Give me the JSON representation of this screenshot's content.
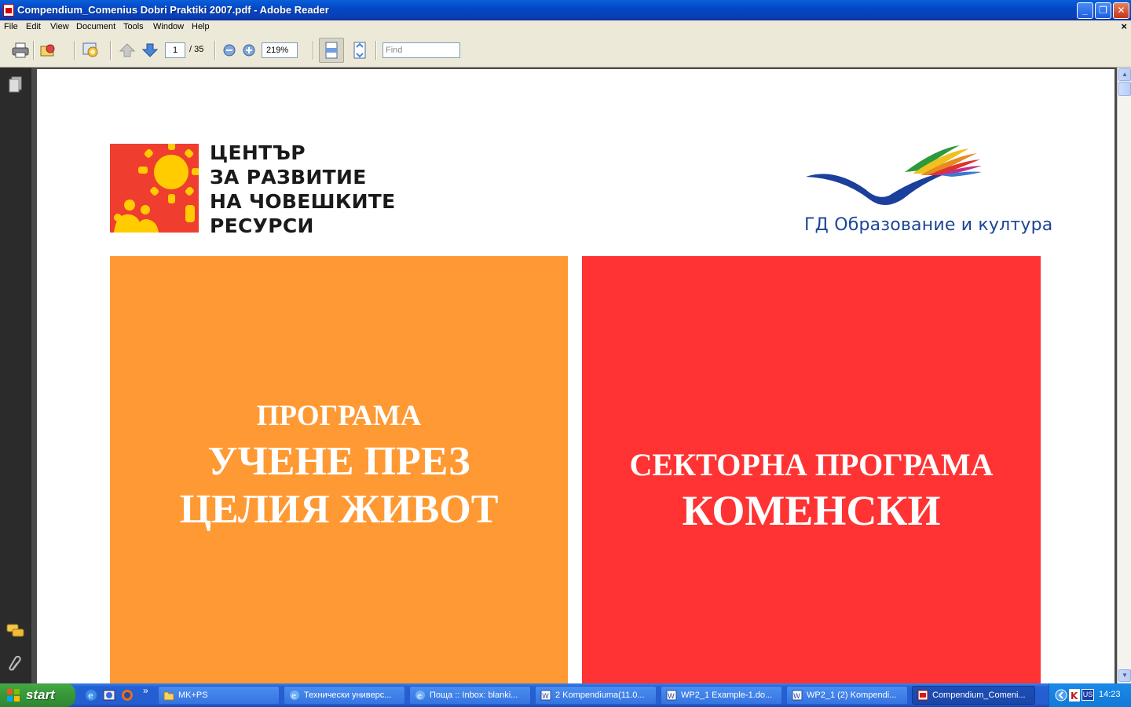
{
  "window": {
    "title": "Compendium_Comenius Dobri Praktiki 2007.pdf - Adobe Reader",
    "controls": {
      "minimize": "_",
      "restore": "❐",
      "close": "✕"
    }
  },
  "menubar": {
    "items": [
      "File",
      "Edit",
      "View",
      "Document",
      "Tools",
      "Window",
      "Help"
    ],
    "doc_close": "×"
  },
  "toolbar": {
    "page_current": "1",
    "page_total": "/ 35",
    "zoom": "219%",
    "find_placeholder": "Find"
  },
  "document": {
    "left_logo_lines": [
      "ЦЕНТЪР",
      "ЗА РАЗВИТИЕ",
      "НА ЧОВЕШКИТЕ",
      "РЕСУРСИ"
    ],
    "right_logo_caption": "ГД  Образование и култура",
    "orange_block": {
      "line1": "ПРОГРАМА",
      "line2": "УЧЕНЕ ПРЕЗ",
      "line3": "ЦЕЛИЯ ЖИВОТ",
      "color": "#ff9933"
    },
    "red_block": {
      "line1": "СЕКТОРНА ПРОГРАМА",
      "line2": "КОМЕНСКИ",
      "color": "#ff3333"
    }
  },
  "taskbar": {
    "start_label": "start",
    "quicklaunch_more": "»",
    "buttons": [
      {
        "label": "MK+PS",
        "icon": "folder-icon"
      },
      {
        "label": "Технически универс...",
        "icon": "ie-icon"
      },
      {
        "label": "Поща :: Inbox: blanki...",
        "icon": "ie-icon"
      },
      {
        "label": "2 Kompendiuma(11.0...",
        "icon": "word-icon"
      },
      {
        "label": "WP2_1 Example-1.do...",
        "icon": "word-icon"
      },
      {
        "label": "WP2_1 (2) Kompendi...",
        "icon": "word-icon"
      },
      {
        "label": "Compendium_Comeni...",
        "icon": "pdf-icon"
      }
    ],
    "tray_lang": "US",
    "clock": "14:23"
  }
}
